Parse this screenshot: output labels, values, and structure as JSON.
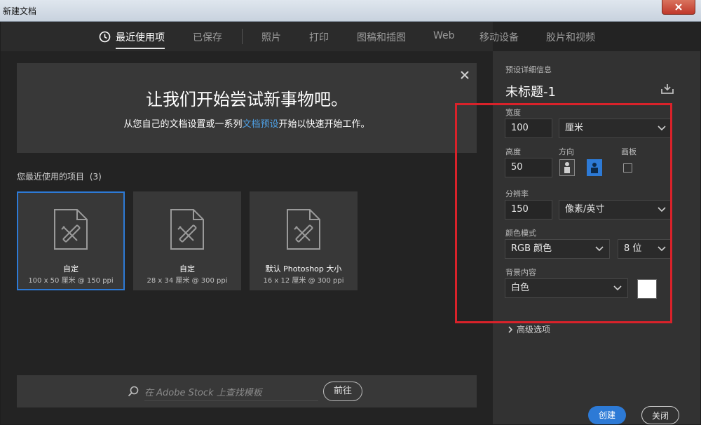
{
  "window": {
    "title": "新建文档"
  },
  "tabs": [
    {
      "label": "最近使用项",
      "active": true
    },
    {
      "label": "已保存"
    },
    {
      "label": "照片"
    },
    {
      "label": "打印"
    },
    {
      "label": "图稿和插图"
    },
    {
      "label": "Web"
    },
    {
      "label": "移动设备"
    },
    {
      "label": "胶片和视频"
    }
  ],
  "banner": {
    "title": "让我们开始尝试新事物吧。",
    "sub_before": "从您自己的文档设置或一系列",
    "sub_link": "文档预设",
    "sub_after": "开始以快速开始工作。"
  },
  "recent": {
    "label": "您最近使用的项目",
    "count": "(3)",
    "items": [
      {
        "name": "自定",
        "meta": "100 x 50 厘米 @ 150 ppi",
        "selected": true
      },
      {
        "name": "自定",
        "meta": "28 x 34 厘米 @ 300 ppi"
      },
      {
        "name": "默认 Photoshop 大小",
        "meta": "16 x 12 厘米 @ 300 ppi"
      }
    ]
  },
  "search": {
    "placeholder": "在 Adobe Stock 上查找模板",
    "go_label": "前往"
  },
  "details": {
    "section_label": "预设详细信息",
    "doc_name": "未标题-1",
    "width_label": "宽度",
    "width_value": "100",
    "width_unit": "厘米",
    "height_label": "高度",
    "height_value": "50",
    "orientation_label": "方向",
    "artboard_label": "画板",
    "resolution_label": "分辨率",
    "resolution_value": "150",
    "resolution_unit": "像素/英寸",
    "color_mode_label": "颜色模式",
    "color_mode": "RGB 颜色",
    "bit_depth": "8 位",
    "background_label": "背景内容",
    "background": "白色",
    "background_color": "#ffffff",
    "advanced_label": "高级选项"
  },
  "actions": {
    "create": "创建",
    "close": "关闭"
  },
  "colors": {
    "accent": "#2d7ad6",
    "link": "#4ea0e4",
    "highlight": "#d9222a"
  }
}
